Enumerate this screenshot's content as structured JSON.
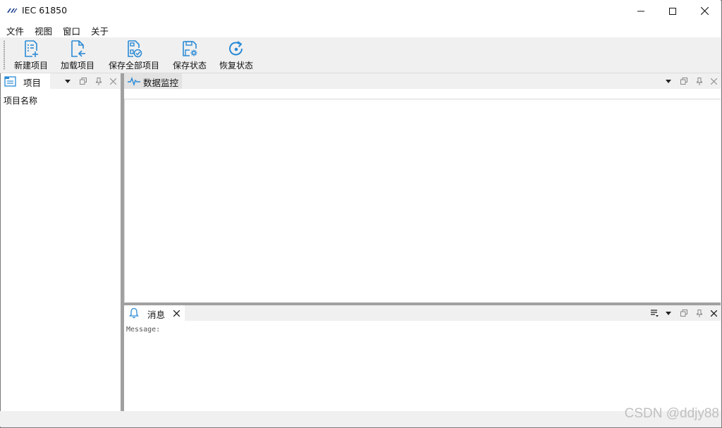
{
  "window": {
    "title": "IEC 61850",
    "controls": [
      "minimize-icon",
      "maximize-icon",
      "close-icon"
    ]
  },
  "menu": {
    "items": [
      "文件",
      "视图",
      "窗口",
      "关于"
    ]
  },
  "toolbar": {
    "buttons": [
      {
        "label": "新建项目",
        "icon": "new-project-icon"
      },
      {
        "label": "加载项目",
        "icon": "load-project-icon"
      },
      {
        "label": "保存全部项目",
        "icon": "save-all-icon"
      },
      {
        "label": "保存状态",
        "icon": "save-state-icon"
      },
      {
        "label": "恢复状态",
        "icon": "restore-state-icon"
      }
    ],
    "accent": "#2a8ad6"
  },
  "project_pane": {
    "tab_label": "项目",
    "tree_header": "项目名称"
  },
  "monitor_pane": {
    "tab_label": "数据监控"
  },
  "message_pane": {
    "tab_label": "消息",
    "content": "Message:"
  },
  "watermark": "CSDN @ddjy88"
}
